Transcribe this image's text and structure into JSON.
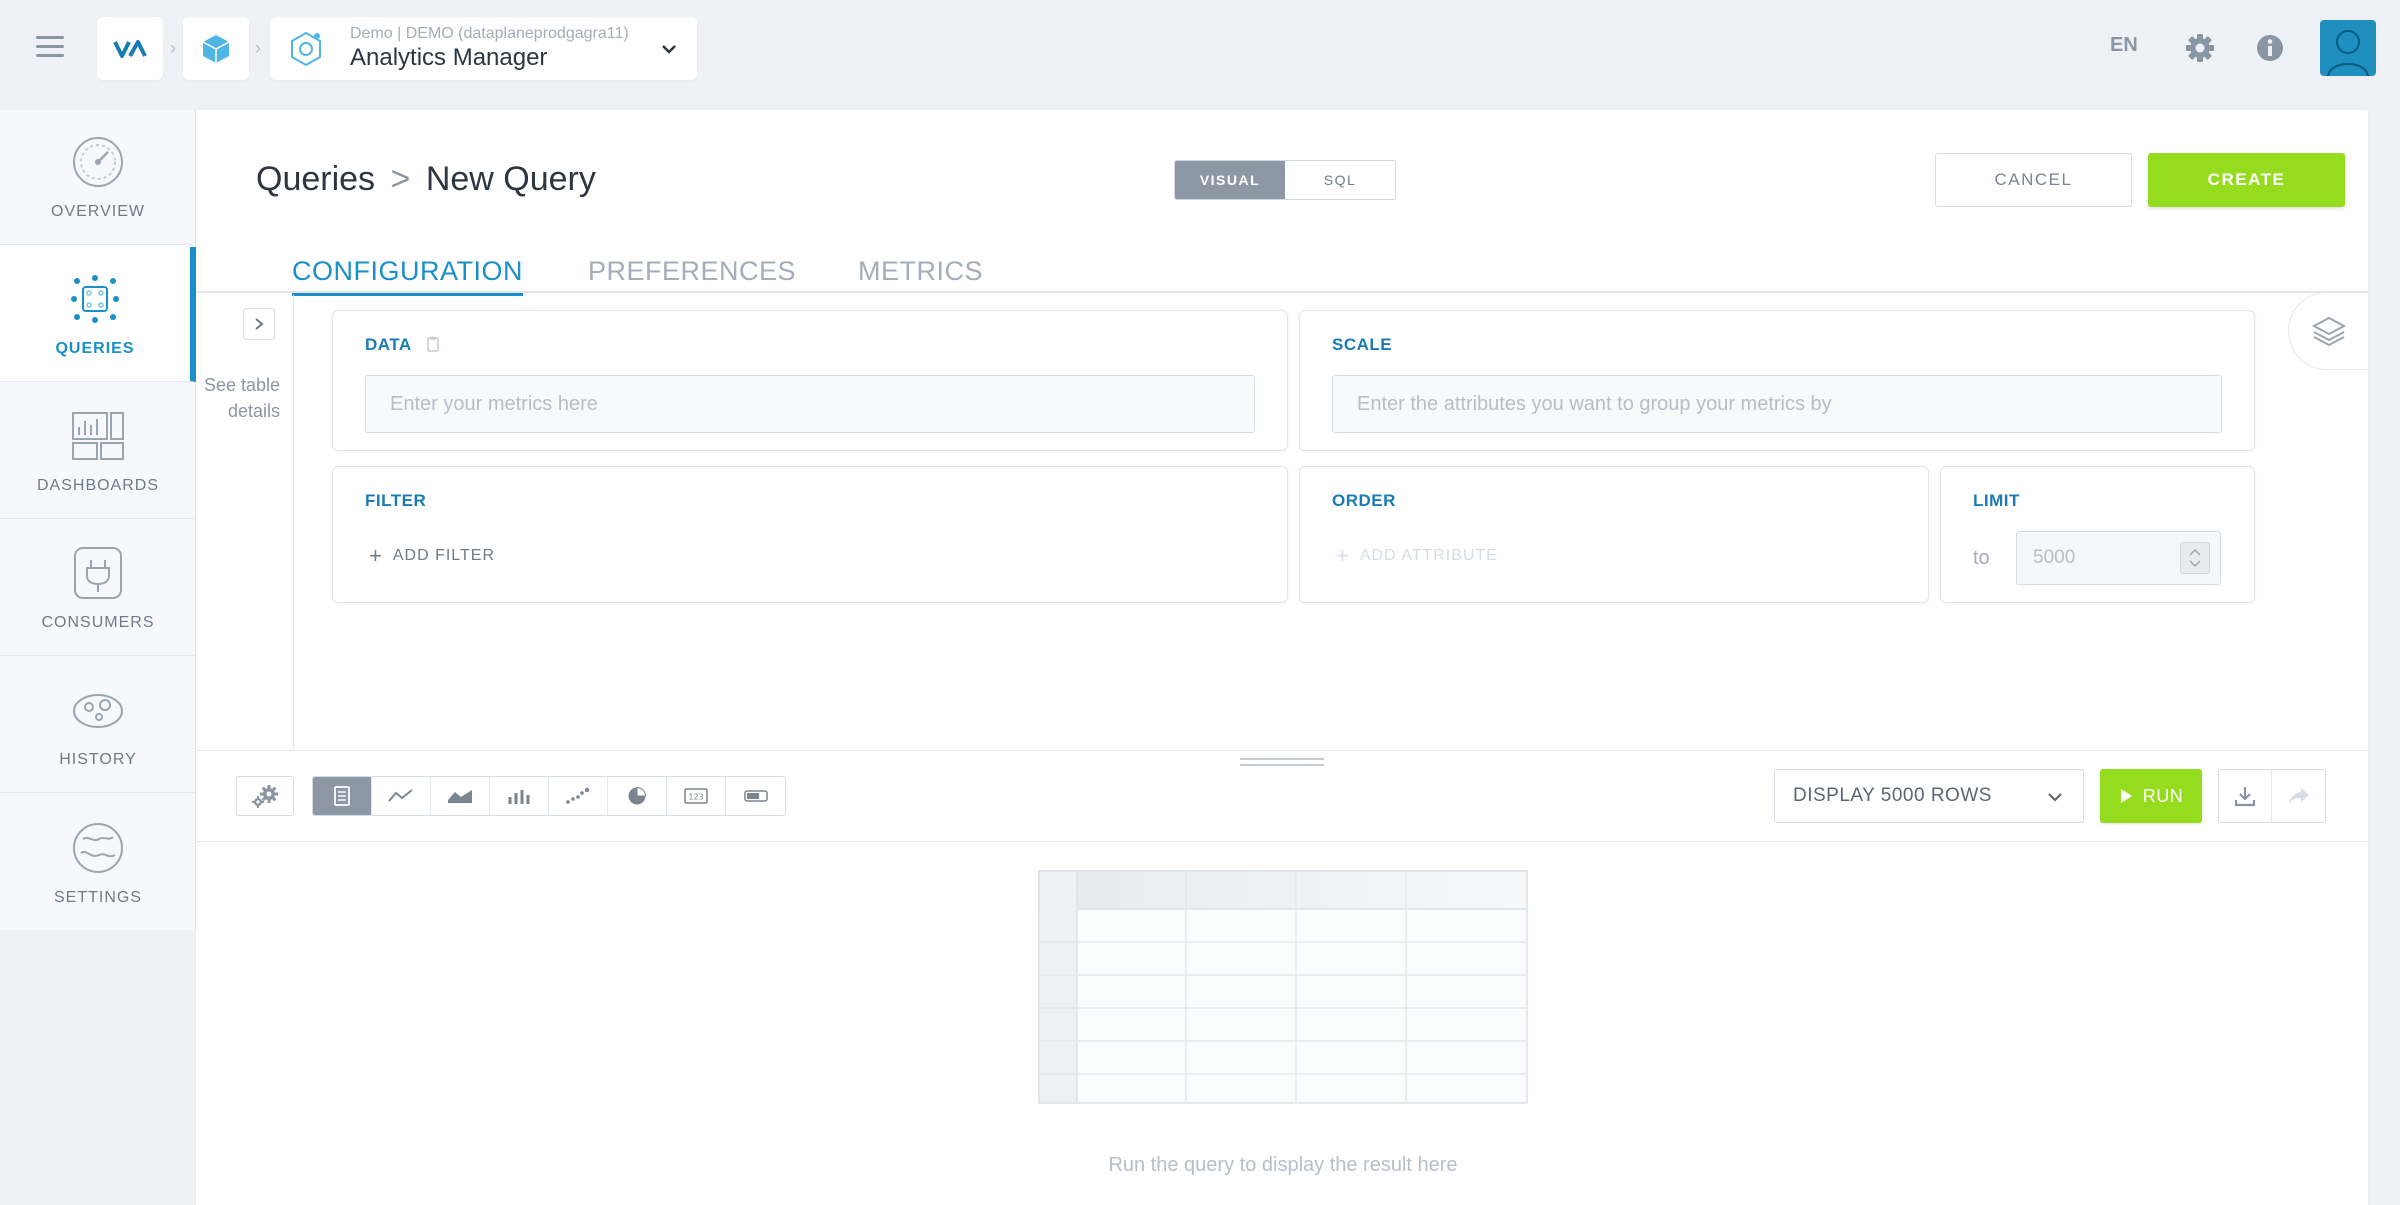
{
  "topbar": {
    "app_subtitle": "Demo | DEMO (dataplaneprodgagra11)",
    "app_title": "Analytics Manager",
    "language": "EN"
  },
  "nav": {
    "items": [
      {
        "label": "OVERVIEW",
        "icon": "overview-gauge-icon"
      },
      {
        "label": "QUERIES",
        "icon": "queries-chip-icon",
        "active": true
      },
      {
        "label": "DASHBOARDS",
        "icon": "dashboards-icon"
      },
      {
        "label": "CONSUMERS",
        "icon": "consumers-plug-icon"
      },
      {
        "label": "HISTORY",
        "icon": "history-icon"
      },
      {
        "label": "SETTINGS",
        "icon": "settings-globe-icon"
      }
    ]
  },
  "page": {
    "breadcrumb_root": "Queries",
    "breadcrumb_sep": ">",
    "breadcrumb_current": "New Query",
    "mode_visual": "VISUAL",
    "mode_sql": "SQL",
    "cancel_label": "CANCEL",
    "create_label": "CREATE"
  },
  "tabs": [
    {
      "label": "CONFIGURATION",
      "active": true
    },
    {
      "label": "PREFERENCES"
    },
    {
      "label": "METRICS"
    }
  ],
  "side": {
    "see_table_line1": "See table",
    "see_table_line2": "details"
  },
  "cards": {
    "data_label": "DATA",
    "data_placeholder": "Enter your metrics here",
    "scale_label": "SCALE",
    "scale_placeholder": "Enter the attributes you want to group your metrics by",
    "filter_label": "FILTER",
    "add_filter": "ADD FILTER",
    "order_label": "ORDER",
    "add_attribute": "ADD ATTRIBUTE",
    "limit_label": "LIMIT",
    "limit_to": "to",
    "limit_value": "5000"
  },
  "toolbar": {
    "chart_types": [
      "table",
      "line",
      "area",
      "bar",
      "scatter",
      "pie",
      "number",
      "gauge"
    ],
    "display_rows": "DISPLAY 5000 ROWS",
    "run_label": "RUN"
  },
  "result": {
    "empty_message": "Run the query to display the result here"
  },
  "colors": {
    "accent_blue": "#1a8fc9",
    "accent_green": "#96dc1e",
    "segment_active": "#8d97a5"
  }
}
